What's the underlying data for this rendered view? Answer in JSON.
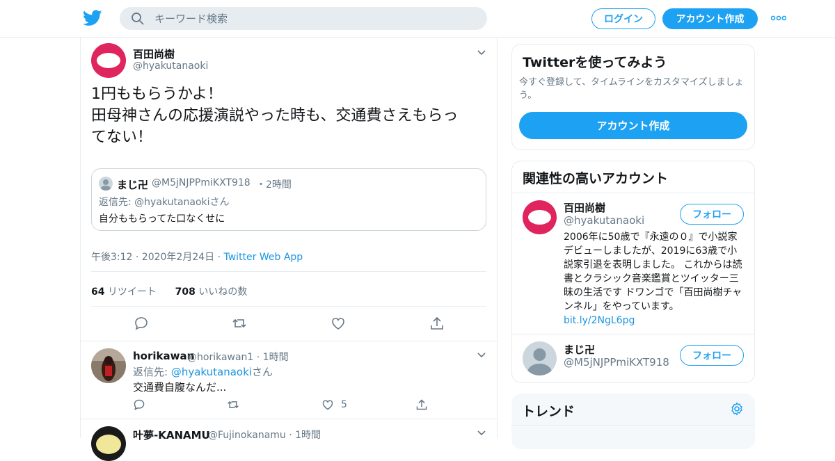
{
  "header": {
    "search_placeholder": "キーワード検索",
    "login_label": "ログイン",
    "signup_label": "アカウント作成"
  },
  "tweet": {
    "author_name": "百田尚樹",
    "author_handle": "@hyakutanaoki",
    "text_lines": [
      "1円ももらうかよ！",
      "田母神さんの応援演説やった時も、交通費さえもらっ",
      "てない！"
    ],
    "quote": {
      "name": "まじ卍",
      "handle": "@M5jNJPPmiKXT918",
      "time": "・2時間",
      "reply_prefix": "返信先: @hyakutanaokiさん",
      "text": "自分ももらってた口なくせに"
    },
    "timestamp": "午後3:12 · 2020年2月24日 · ",
    "app": "Twitter Web App",
    "retweet_count": "64",
    "retweet_label": " リツイート",
    "like_count": "708",
    "like_label": " いいねの数"
  },
  "replies": [
    {
      "name": "horikawan",
      "handle": "@horikawan1 · 1時間",
      "reply_to_prefix": "返信先: ",
      "reply_to_handle": "@hyakutanaoki",
      "reply_to_suffix": "さん",
      "text": "交通費自腹なんだ...",
      "like_count": "5"
    },
    {
      "name": "叶夢-KANAMU",
      "handle": "@Fujinokanamu · 1時間"
    }
  ],
  "sidebar": {
    "try": {
      "title": "Twitterを使ってみよう",
      "desc": "今すぐ登録して、タイムラインをカスタマイズしましょう。",
      "button": "アカウント作成"
    },
    "related": {
      "title": "関連性の高いアカウント",
      "accounts": [
        {
          "name": "百田尚樹",
          "handle": "@hyakutanaoki",
          "follow": "フォロー",
          "bio": "2006年に50歳で『永遠の０』で小説家デビューしましたが、2019に63歳で小説家引退を表明しました。 これからは読書とクラシック音楽鑑賞とツイッター三昧の生活です ドワンゴで「百田尚樹チャンネル」をやっています。",
          "link": "bit.ly/2NgL6pg"
        },
        {
          "name": "まじ卍",
          "handle": "@M5jNJPPmiKXT918",
          "follow": "フォロー"
        }
      ]
    },
    "trends": {
      "title": "トレンド"
    }
  },
  "colors": {
    "accent": "#1da1f2",
    "link": "#1b95e0",
    "brand_avatar": "#e0245e",
    "muted": "#657786"
  }
}
